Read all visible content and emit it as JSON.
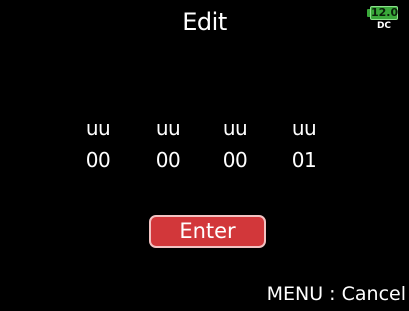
{
  "header": {
    "title": "Edit"
  },
  "battery": {
    "voltage": "12.0",
    "source": "DC",
    "color": "#3aa83a"
  },
  "fields": [
    {
      "label": "uu",
      "value": "00"
    },
    {
      "label": "uu",
      "value": "00"
    },
    {
      "label": "uu",
      "value": "00"
    },
    {
      "label": "uu",
      "value": "01"
    }
  ],
  "enter_button": {
    "label": "Enter",
    "color": "#d2373a"
  },
  "footer": {
    "menu_hint": "MENU : Cancel"
  }
}
